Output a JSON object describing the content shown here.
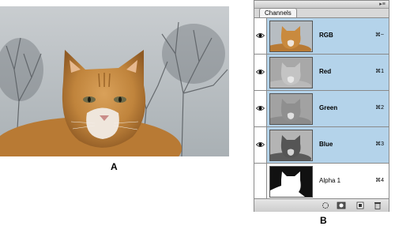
{
  "figure_labels": {
    "a": "A",
    "b": "B"
  },
  "palette": {
    "tab": "Channels",
    "menu_icon": "panel-menu-icon",
    "channels": [
      {
        "name": "RGB",
        "shortcut": "⌘~",
        "visible": true,
        "selected": true,
        "thumb": "color"
      },
      {
        "name": "Red",
        "shortcut": "⌘1",
        "visible": true,
        "selected": true,
        "thumb": "gray-light"
      },
      {
        "name": "Green",
        "shortcut": "⌘2",
        "visible": true,
        "selected": true,
        "thumb": "gray-mid"
      },
      {
        "name": "Blue",
        "shortcut": "⌘3",
        "visible": true,
        "selected": true,
        "thumb": "gray-dark"
      },
      {
        "name": "Alpha 1",
        "shortcut": "⌘4",
        "visible": false,
        "selected": false,
        "thumb": "mask"
      }
    ],
    "bottom_buttons": [
      "load-channel-as-selection-icon",
      "save-selection-as-channel-icon",
      "new-channel-icon",
      "delete-channel-icon"
    ]
  },
  "colors": {
    "selected_row": "#b4d3ea",
    "cat_orange": "#c98a3e",
    "sky": "#b8bec4"
  }
}
